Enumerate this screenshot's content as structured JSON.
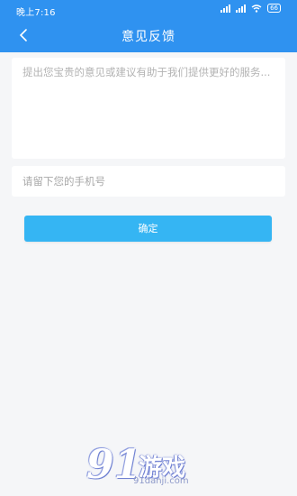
{
  "status_bar": {
    "time": "晚上7:16",
    "battery": "66"
  },
  "header": {
    "title": "意见反馈"
  },
  "form": {
    "feedback_placeholder": "提出您宝贵的意见或建议有助于我们提供更好的服务...",
    "phone_placeholder": "请留下您的手机号",
    "confirm_label": "确定"
  },
  "watermark": {
    "number": "91",
    "text": "游戏",
    "url": "91danji.com"
  },
  "colors": {
    "header": "#2f92f0",
    "button": "#35b5f3",
    "background": "#f5f6f8"
  }
}
